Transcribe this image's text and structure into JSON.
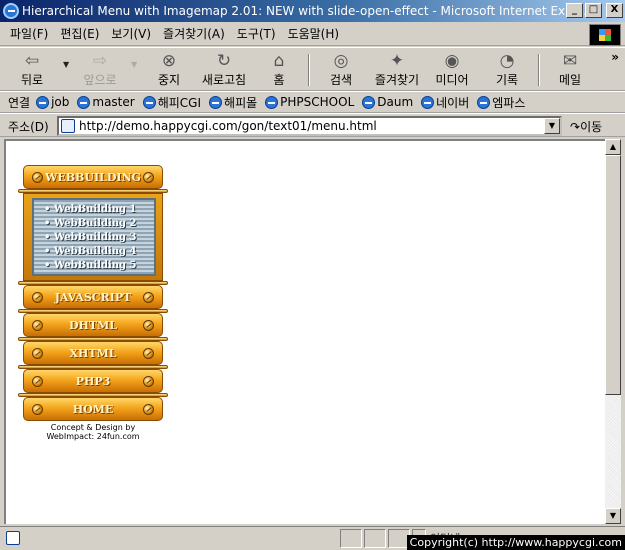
{
  "window": {
    "title": "Hierarchical Menu with Imagemap 2.01: NEW with slide-open-effect - Microsoft Internet Explo...",
    "minimize": "_",
    "maximize": "□",
    "close": "X"
  },
  "menubar": [
    "파일(F)",
    "편집(E)",
    "보기(V)",
    "즐겨찾기(A)",
    "도구(T)",
    "도움말(H)"
  ],
  "toolbar": {
    "back": "뒤로",
    "forward": "앞으로",
    "stop": "중지",
    "refresh": "새로고침",
    "home": "홈",
    "search": "검색",
    "favorites": "즐겨찾기",
    "media": "미디어",
    "history": "기록",
    "mail": "메일",
    "more": "»"
  },
  "links": {
    "label": "연결",
    "items": [
      "job",
      "master",
      "해피CGI",
      "해피몰",
      "PHPSCHOOL",
      "Daum",
      "네이버",
      "엠파스"
    ],
    "more": "»"
  },
  "address": {
    "label": "주소(D)",
    "url": "http://demo.happycgi.com/gon/text01/menu.html",
    "go": "이동"
  },
  "menu": {
    "top": "WEBBUILDING",
    "subitems": [
      "• WebBuilding 1",
      "• WebBuilding 2",
      "• WebBuilding 3",
      "• WebBuilding 4",
      "• WebBuilding 5"
    ],
    "rest": [
      "JAVASCRIPT",
      "DHTML",
      "XHTML",
      "PHP3",
      "HOME"
    ],
    "credit_line1": "Concept & Design by",
    "credit_line2": "WebImpact: 24fun.com"
  },
  "status": {
    "zone": "인터넷",
    "watermark": "Copyright(c) http://www.happycgi.com"
  },
  "icons": {
    "back": "back-arrow-icon",
    "forward": "forward-arrow-icon",
    "stop": "stop-icon",
    "refresh": "refresh-icon",
    "home": "home-icon",
    "search": "search-icon",
    "favorites": "favorites-icon",
    "media": "media-icon",
    "history": "history-icon",
    "mail": "mail-icon"
  }
}
